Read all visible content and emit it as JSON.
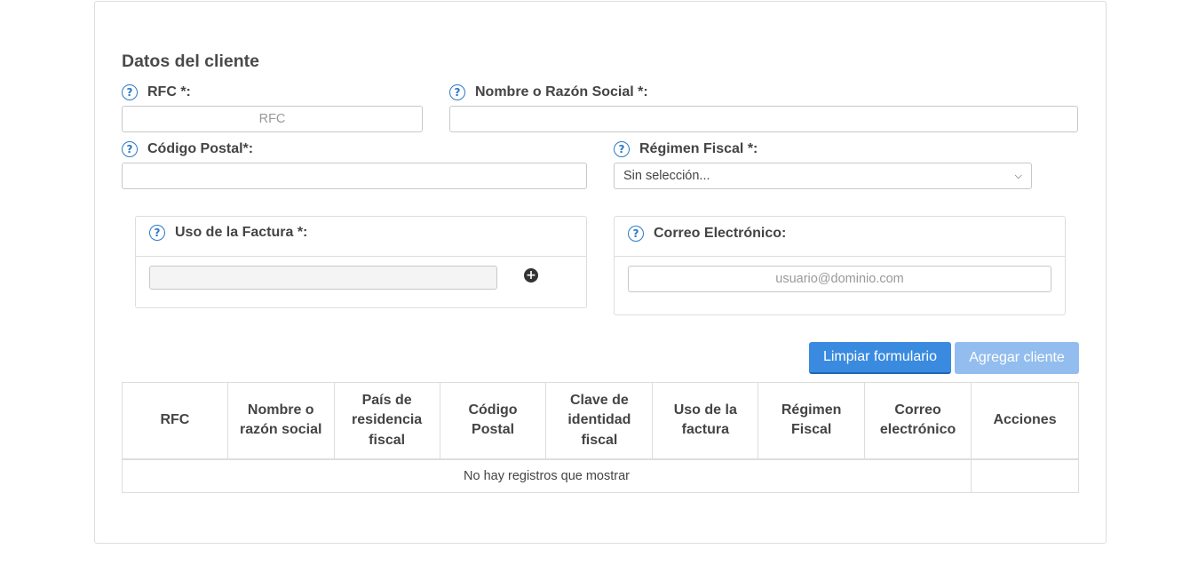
{
  "section": {
    "title": "Datos del cliente"
  },
  "fields": {
    "rfc": {
      "label": "RFC *:",
      "placeholder": "RFC",
      "value": ""
    },
    "nombre": {
      "label": "Nombre o Razón Social *:",
      "value": ""
    },
    "codigo_postal": {
      "label": "Código Postal*:",
      "value": ""
    },
    "regimen": {
      "label": "Régimen Fiscal *:",
      "selected": "Sin selección..."
    },
    "uso_factura": {
      "label": "Uso de la Factura *:",
      "value": ""
    },
    "correo": {
      "label": "Correo Electrónico:",
      "placeholder": "usuario@dominio.com",
      "value": ""
    }
  },
  "buttons": {
    "limpiar": "Limpiar formulario",
    "agregar": "Agregar cliente"
  },
  "table": {
    "headers": [
      "RFC",
      "Nombre o razón social",
      "País de residencia fiscal",
      "Código Postal",
      "Clave de identidad fiscal",
      "Uso de la factura",
      "Régimen Fiscal",
      "Correo electrónico",
      "Acciones"
    ],
    "empty_message": "No hay registros que mostrar"
  },
  "icons": {
    "help": "question-circle-icon",
    "add": "plus-circle-icon",
    "dropdown": "chevron-down-icon"
  },
  "colors": {
    "primary": "#3a8be0",
    "primary_disabled": "#93bdee",
    "help_icon": "#2b79c9",
    "border": "#dddddd"
  }
}
